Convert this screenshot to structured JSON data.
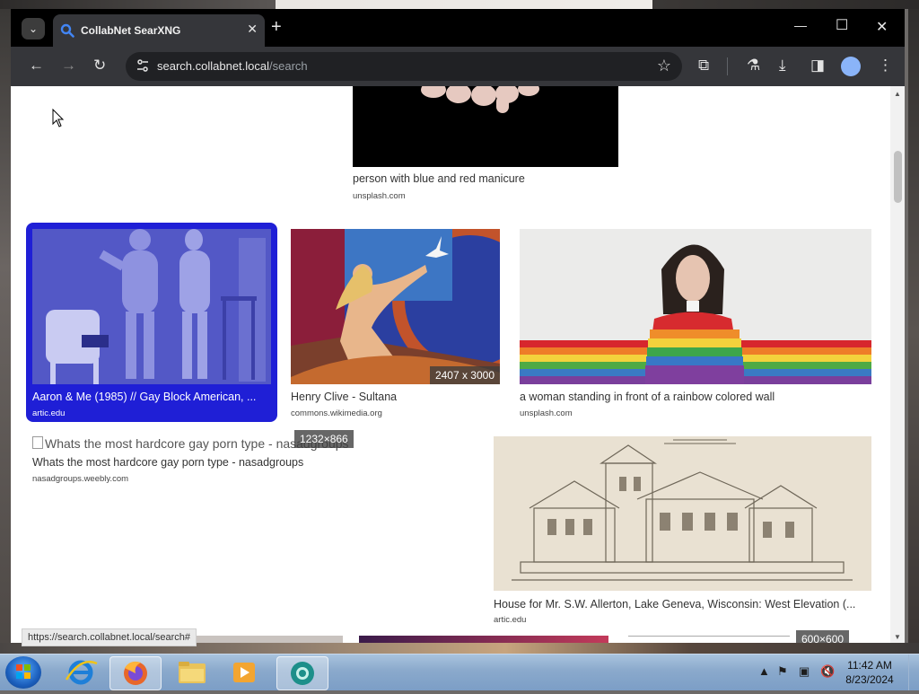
{
  "browser": {
    "tab_title": "CollabNet SearXNG",
    "tab_close": "✕",
    "new_tab": "+",
    "url_host": "search.collabnet.local",
    "url_path": "/search",
    "status_url": "https://search.collabnet.local/search#"
  },
  "results": [
    {
      "title": "person with blue and red manicure",
      "source": "unsplash.com"
    },
    {
      "title": "Aaron & Me (1985) // Gay Block American, ...",
      "source": "artic.edu"
    },
    {
      "title": "Henry Clive - Sultana",
      "source": "commons.wikimedia.org",
      "resolution": "2407 x 3000"
    },
    {
      "title": "a woman standing in front of a rainbow colored wall",
      "source": "unsplash.com"
    },
    {
      "title": "Whats the most hardcore gay porn type - nasadgroups",
      "alt": "Whats the most hardcore gay porn type - nasadgroups",
      "source": "nasadgroups.weebly.com",
      "resolution": "1232×866"
    },
    {
      "title": "House for Mr. S.W. Allerton, Lake Geneva, Wisconsin: West Elevation (...",
      "source": "artic.edu"
    },
    {
      "resolution": "600×600"
    }
  ],
  "taskbar": {
    "time": "11:42 AM",
    "date": "8/23/2024"
  },
  "colors": {
    "selected": "#1f1fd6",
    "chrome_dark": "#35363a"
  }
}
